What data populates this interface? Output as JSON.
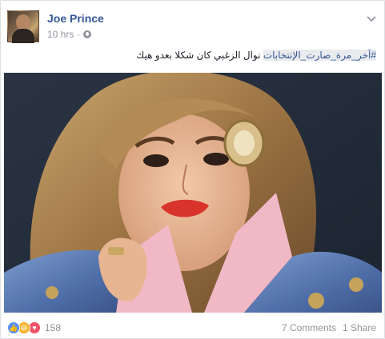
{
  "post": {
    "author": "Joe Prince",
    "timestamp": "10 hrs",
    "separator": "·",
    "privacy_icon": "globe-icon",
    "hashtag": "#آخر_مرة_صارت_الإنتخابات",
    "text": " نوال الزغبي كان شكلا بعدو هيك",
    "photo_description": "portrait-photo"
  },
  "footer": {
    "reactions": [
      "like-icon",
      "haha-icon",
      "love-icon"
    ],
    "reaction_count": "158",
    "comments_label": "7 Comments",
    "share_label": "1 Share"
  },
  "colors": {
    "link": "#365899",
    "muted": "#90949c",
    "like": "#5890ff",
    "haha": "#f7b125",
    "love": "#f25268"
  }
}
